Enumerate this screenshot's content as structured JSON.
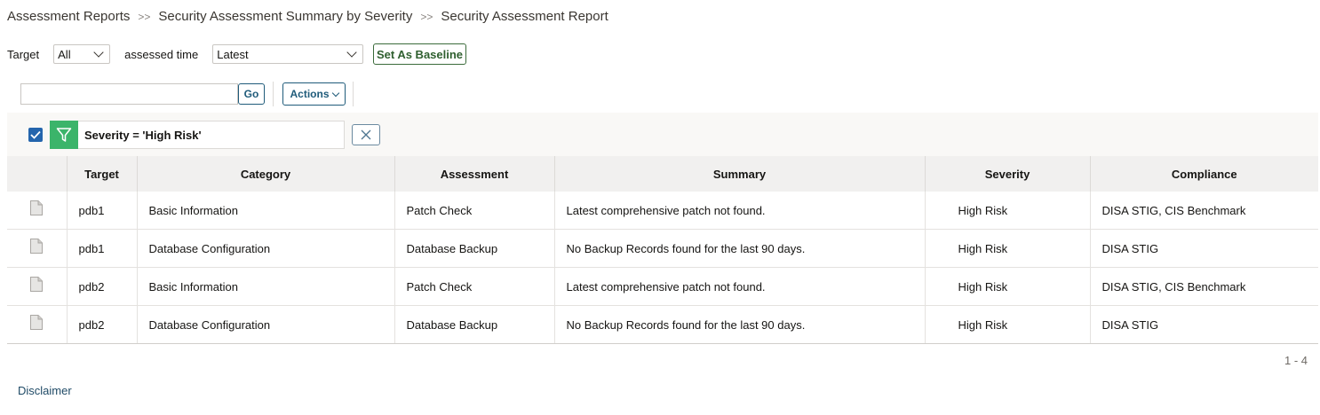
{
  "breadcrumb": {
    "items": [
      "Assessment Reports",
      "Security Assessment Summary by Severity",
      "Security Assessment Report"
    ],
    "separator": ">>"
  },
  "filters": {
    "target_label": "Target",
    "target_value": "All",
    "assessed_time_label": "assessed time",
    "assessed_time_value": "Latest",
    "baseline_button": "Set As Baseline"
  },
  "search": {
    "value": "",
    "go_label": "Go",
    "actions_label": "Actions"
  },
  "active_filter": {
    "checked": true,
    "text": "Severity = 'High Risk'"
  },
  "table": {
    "columns": [
      "Target",
      "Category",
      "Assessment",
      "Summary",
      "Severity",
      "Compliance"
    ],
    "rows": [
      {
        "target": "pdb1",
        "category": "Basic Information",
        "assessment": "Patch Check",
        "summary": "Latest comprehensive patch not found.",
        "severity": "High Risk",
        "compliance": "DISA STIG, CIS Benchmark"
      },
      {
        "target": "pdb1",
        "category": "Database Configuration",
        "assessment": "Database Backup",
        "summary": "No Backup Records found for the last 90 days.",
        "severity": "High Risk",
        "compliance": "DISA STIG"
      },
      {
        "target": "pdb2",
        "category": "Basic Information",
        "assessment": "Patch Check",
        "summary": "Latest comprehensive patch not found.",
        "severity": "High Risk",
        "compliance": "DISA STIG, CIS Benchmark"
      },
      {
        "target": "pdb2",
        "category": "Database Configuration",
        "assessment": "Database Backup",
        "summary": "No Backup Records found for the last 90 days.",
        "severity": "High Risk",
        "compliance": "DISA STIG"
      }
    ]
  },
  "pagination": "1 - 4",
  "footer": {
    "disclaimer": "Disclaimer"
  },
  "colors": {
    "severity_high": "#d4050d",
    "filter_green": "#3bb46a",
    "checkbox_blue": "#2465ad",
    "baseline_green": "#2f5f2f",
    "button_blue": "#1f5b7a"
  },
  "icons": {
    "row_icon": "document-icon",
    "filter_icon": "funnel-icon",
    "clear_icon": "close-icon",
    "dropdown_icon": "chevron-down-icon"
  }
}
